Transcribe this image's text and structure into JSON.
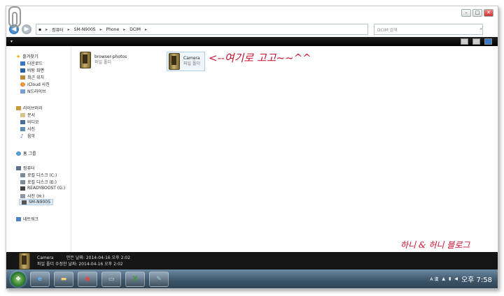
{
  "window": {
    "address": [
      "컴퓨터",
      "SM-N900S",
      "Phone",
      "DCIM"
    ],
    "search_placeholder": "DCIM 검색",
    "win_buttons": [
      "–",
      "□",
      "✕"
    ]
  },
  "sidebar": {
    "favorites": {
      "label": "즐겨찾기",
      "items": [
        "다운로드",
        "바탕 화면",
        "최근 위치",
        "iCloud 사진",
        "N드라이브"
      ]
    },
    "libraries": {
      "label": "라이브러리",
      "items": [
        "문서",
        "비디오",
        "사진",
        "음악"
      ]
    },
    "homegroup": "홈 그룹",
    "computer": {
      "label": "컴퓨터",
      "items": [
        "로컬 디스크 (C:)",
        "로컬 디스크 (E:)",
        "READYBOOST (G:)",
        "사진 (H:)",
        "SM-N900S"
      ]
    },
    "network": "네트워크"
  },
  "content": {
    "folders": [
      {
        "name": "browser-photos",
        "type": "파일 폴더"
      },
      {
        "name": "Camera",
        "type": "파일 폴더"
      }
    ],
    "annotation": "<--여기로 고고~~^^",
    "watermark": "하니 & 허니 블로그"
  },
  "details": {
    "name": "Camera",
    "line1_label": "만든 날짜:",
    "line1_value": "2014-04-16 오후 2:02",
    "type": "파일 폴더",
    "line2_label": "수정한 날짜:",
    "line2_value": "2014-04-16 오후 2:02"
  },
  "taskbar": {
    "ime": "A 漢",
    "clock": "오후 7:58"
  }
}
